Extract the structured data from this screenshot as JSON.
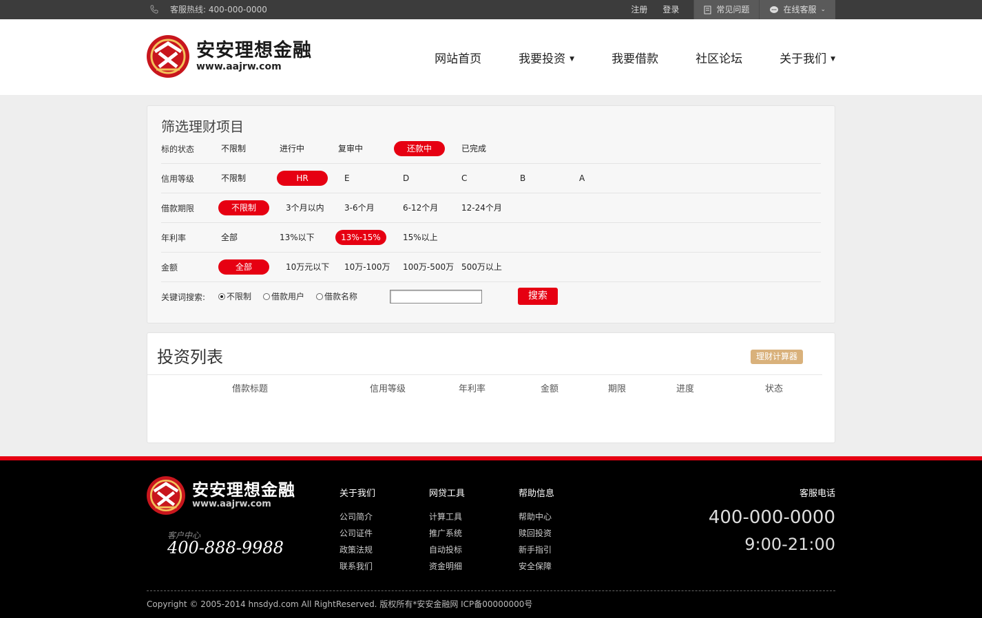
{
  "topbar": {
    "hotline": "客服热线: 400-000-0000",
    "register": "注册",
    "login": "登录",
    "faq": "常见问题",
    "online_service": "在线客服"
  },
  "header": {
    "logo_cn": "安安理想金融",
    "logo_en": "www.aajrw.com",
    "nav": [
      "网站首页",
      "我要投资",
      "我要借款",
      "社区论坛",
      "关于我们"
    ]
  },
  "filter": {
    "title": "筛选理财项目",
    "rows": [
      {
        "label": "标的状态",
        "options": [
          "不限制",
          "进行中",
          "复审中",
          "还款中",
          "已完成"
        ],
        "selected": "还款中"
      },
      {
        "label": "信用等级",
        "options": [
          "不限制",
          "HR",
          "E",
          "D",
          "C",
          "B",
          "A"
        ],
        "selected": "HR"
      },
      {
        "label": "借款期限",
        "options": [
          "不限制",
          "3个月以内",
          "3-6个月",
          "6-12个月",
          "12-24个月"
        ],
        "selected": "不限制"
      },
      {
        "label": "年利率",
        "options": [
          "全部",
          "13%以下",
          "13%-15%",
          "15%以上"
        ],
        "selected": "13%-15%"
      },
      {
        "label": "金额",
        "options": [
          "全部",
          "10万元以下",
          "10万-100万",
          "100万-500万",
          "500万以上"
        ],
        "selected": "全部"
      }
    ],
    "keyword": {
      "label": "关键词搜索:",
      "radios": [
        "不限制",
        "借款用户",
        "借款名称"
      ],
      "selected": "不限制",
      "value": "",
      "search": "搜索"
    }
  },
  "invest": {
    "title": "投资列表",
    "calc": "理财计算器",
    "columns": [
      "借款标题",
      "信用等级",
      "年利率",
      "金额",
      "期限",
      "进度",
      "状态"
    ]
  },
  "footer": {
    "logo_cn": "安安理想金融",
    "logo_en": "www.aajrw.com",
    "service_caption": "客户中心",
    "service_number": "400-888-9988",
    "cols": [
      {
        "title": "关于我们",
        "links": [
          "公司简介",
          "公司证件",
          "政策法规",
          "联系我们"
        ]
      },
      {
        "title": "网贷工具",
        "links": [
          "计算工具",
          "推广系统",
          "自动投标",
          "资金明细"
        ]
      },
      {
        "title": "帮助信息",
        "links": [
          "帮助中心",
          "赎回投资",
          "新手指引",
          "安全保障"
        ]
      }
    ],
    "contact_title": "客服电话",
    "contact_phone": "400-000-0000",
    "contact_hours": "9:00-21:00",
    "copyright": "Copyright © 2005-2014 hnsdyd.com All RightReserved. 版权所有*安安金融网 ICP备00000000号"
  },
  "colors": {
    "brand_red": "#e60012",
    "calc_gold": "#d9b17b"
  }
}
